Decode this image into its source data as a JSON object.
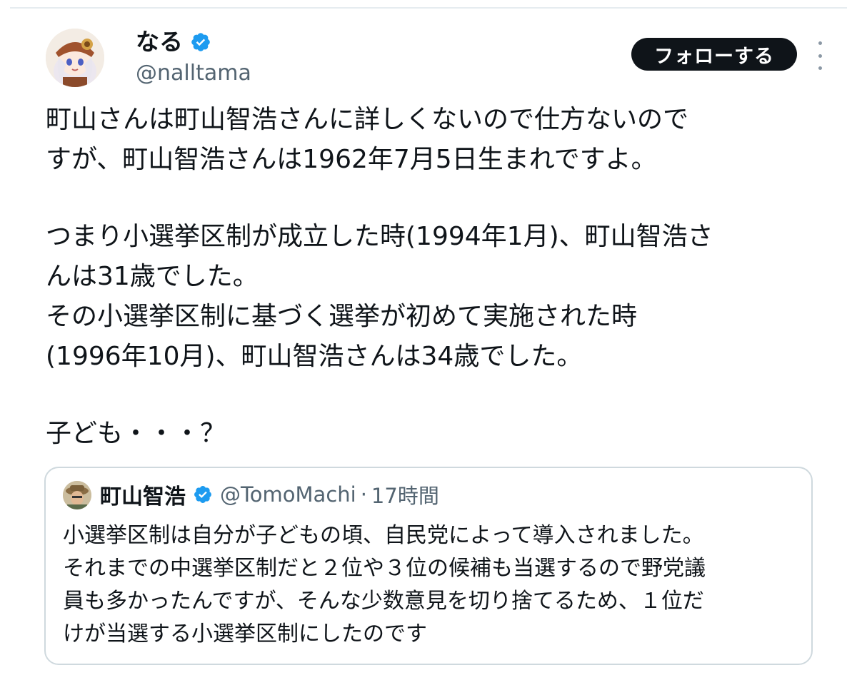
{
  "author": {
    "name": "なる",
    "handle": "@nalltama"
  },
  "follow_button": {
    "label": "フォローする"
  },
  "tweet": {
    "lines": [
      "町山さんは町山智浩さんに詳しくないので仕方ないので",
      "すが、町山智浩さんは1962年7月5日生まれですよ。",
      "",
      "つまり小選挙区制が成立した時(1994年1月)、町山智浩さ",
      "んは31歳でした。",
      "その小選挙区制に基づく選挙が初めて実施された時",
      "(1996年10月)、町山智浩さんは34歳でした。",
      "",
      "子ども・・・？"
    ]
  },
  "quote": {
    "name": "町山智浩",
    "handle": "@TomoMachi",
    "separator": "·",
    "time": "17時間",
    "lines": [
      "小選挙区制は自分が子どもの頃、自民党によって導入されました。",
      "それまでの中選挙区制だと２位や３位の候補も当選するので野党議",
      "員も多かったんですが、そんな少数意見を切り捨てるため、１位だ",
      "けが当選する小選挙区制にしたのです"
    ]
  },
  "colors": {
    "verified_blue": "#1d9bf0",
    "follow_bg": "#0f1419",
    "muted_text": "#536471",
    "border": "#cfd9de"
  },
  "icons": {
    "verified": "verified-badge-icon",
    "more": "more-vertical-icon"
  }
}
